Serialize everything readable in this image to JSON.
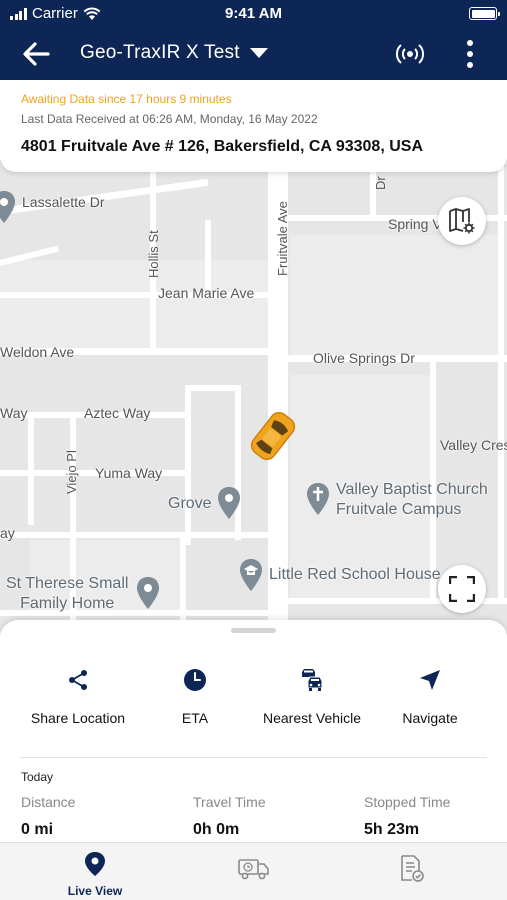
{
  "status_bar": {
    "carrier": "Carrier",
    "time": "9:41 AM"
  },
  "nav": {
    "title": "Geo-TraxIR X Test"
  },
  "info": {
    "awaiting": "Awaiting Data since 17 hours 9 minutes",
    "last_received": "Last Data Received at 06:26 AM, Monday, 16 May 2022",
    "address": "4801 Fruitvale Ave # 126, Bakersfield, CA 93308, USA"
  },
  "map": {
    "streets": {
      "lassalette": "Lassalette Dr",
      "hollis": "Hollis St",
      "fruitvale": "Fruitvale Ave",
      "spring": "Spring V",
      "jean_marie": "Jean Marie Ave",
      "weldon": "Weldon Ave",
      "olive_springs": "Olive Springs Dr",
      "way": "Way",
      "aztec": "Aztec Way",
      "valley_cres": "Valley Cres",
      "viejo": "Viejo Pl",
      "yuma": "Yuma Way",
      "ay": "ay",
      "dr_top": "Dr"
    },
    "pois": {
      "grove": "Grove",
      "church_line1": "Valley Baptist Church",
      "church_line2": "Fruitvale Campus",
      "school": "Little Red School House",
      "st_therese_line1": "St Therese Small",
      "st_therese_line2": "Family Home"
    },
    "vehicle_color": "#f0a31c"
  },
  "actions": [
    {
      "label": "Share Location",
      "icon": "share-icon"
    },
    {
      "label": "ETA",
      "icon": "clock-icon"
    },
    {
      "label": "Nearest Vehicle",
      "icon": "cars-icon"
    },
    {
      "label": "Navigate",
      "icon": "navigate-icon"
    }
  ],
  "today": {
    "heading": "Today",
    "distance_label": "Distance",
    "distance_value": "0 mi",
    "travel_label": "Travel Time",
    "travel_value": "0h 0m",
    "stopped_label": "Stopped Time",
    "stopped_value": "5h 23m"
  },
  "tabs": [
    {
      "label": "Live View",
      "icon": "location-pin-icon",
      "active": true
    },
    {
      "label": "",
      "icon": "delivery-truck-icon",
      "active": false
    },
    {
      "label": "",
      "icon": "report-document-icon",
      "active": false
    }
  ],
  "colors": {
    "header": "#0d2656",
    "accent_orange": "#f0a31c",
    "icon_navy": "#0d2656"
  }
}
